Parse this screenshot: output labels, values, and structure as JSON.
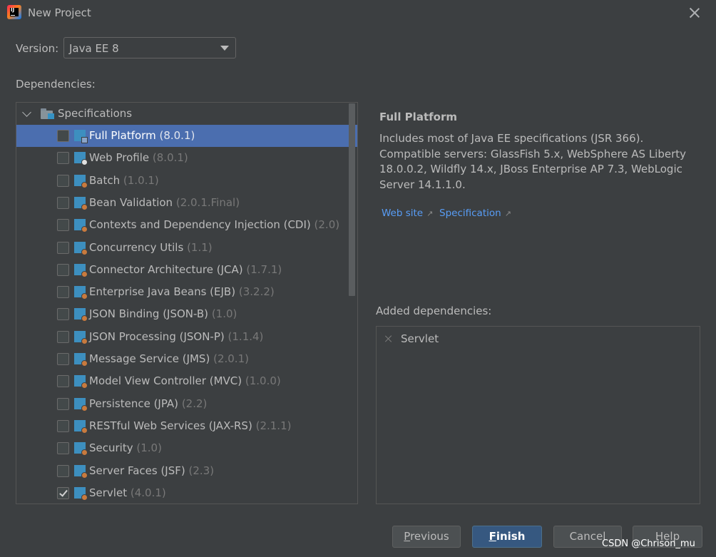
{
  "window": {
    "title": "New Project",
    "icon": "intellij-idea-icon",
    "close_icon": "close-icon"
  },
  "version": {
    "label": "Version:",
    "selected": "Java EE 8"
  },
  "dependencies": {
    "label": "Dependencies:",
    "group": "Specifications",
    "items": [
      {
        "name": "Full Platform",
        "version": "(8.0.1)",
        "checked": false,
        "selected": true
      },
      {
        "name": "Web Profile",
        "version": "(8.0.1)",
        "checked": false,
        "selected": false
      },
      {
        "name": "Batch",
        "version": "(1.0.1)",
        "checked": false,
        "selected": false
      },
      {
        "name": "Bean Validation",
        "version": "(2.0.1.Final)",
        "checked": false,
        "selected": false
      },
      {
        "name": "Contexts and Dependency Injection (CDI)",
        "version": "(2.0)",
        "checked": false,
        "selected": false
      },
      {
        "name": "Concurrency Utils",
        "version": "(1.1)",
        "checked": false,
        "selected": false
      },
      {
        "name": "Connector Architecture (JCA)",
        "version": "(1.7.1)",
        "checked": false,
        "selected": false
      },
      {
        "name": "Enterprise Java Beans (EJB)",
        "version": "(3.2.2)",
        "checked": false,
        "selected": false
      },
      {
        "name": "JSON Binding (JSON-B)",
        "version": "(1.0)",
        "checked": false,
        "selected": false
      },
      {
        "name": "JSON Processing (JSON-P)",
        "version": "(1.1.4)",
        "checked": false,
        "selected": false
      },
      {
        "name": "Message Service (JMS)",
        "version": "(2.0.1)",
        "checked": false,
        "selected": false
      },
      {
        "name": "Model View Controller (MVC)",
        "version": "(1.0.0)",
        "checked": false,
        "selected": false
      },
      {
        "name": "Persistence (JPA)",
        "version": "(2.2)",
        "checked": false,
        "selected": false
      },
      {
        "name": "RESTful Web Services (JAX-RS)",
        "version": "(2.1.1)",
        "checked": false,
        "selected": false
      },
      {
        "name": "Security",
        "version": "(1.0)",
        "checked": false,
        "selected": false
      },
      {
        "name": "Server Faces (JSF)",
        "version": "(2.3)",
        "checked": false,
        "selected": false
      },
      {
        "name": "Servlet",
        "version": "(4.0.1)",
        "checked": true,
        "selected": false
      }
    ]
  },
  "details": {
    "title": "Full Platform",
    "description": "Includes most of Java EE specifications (JSR 366). Compatible servers: GlassFish 5.x, WebSphere AS Liberty 18.0.0.2, Wildfly 14.x, JBoss Enterprise AP 7.3, WebLogic Server 14.1.1.0.",
    "links": {
      "website": "Web site",
      "specification": "Specification",
      "arrow": "↗"
    }
  },
  "added": {
    "label": "Added dependencies:",
    "items": [
      "Servlet"
    ]
  },
  "buttons": {
    "previous": {
      "mnemonic": "P",
      "rest": "revious"
    },
    "finish": {
      "mnemonic": "F",
      "rest": "inish"
    },
    "cancel": "Cancel",
    "help": "Help"
  },
  "watermark": "CSDN @Chrison_mu",
  "colors": {
    "background": "#3c3f41",
    "selection": "#4b6eaf",
    "link": "#589df6",
    "default_button": "#365880"
  }
}
